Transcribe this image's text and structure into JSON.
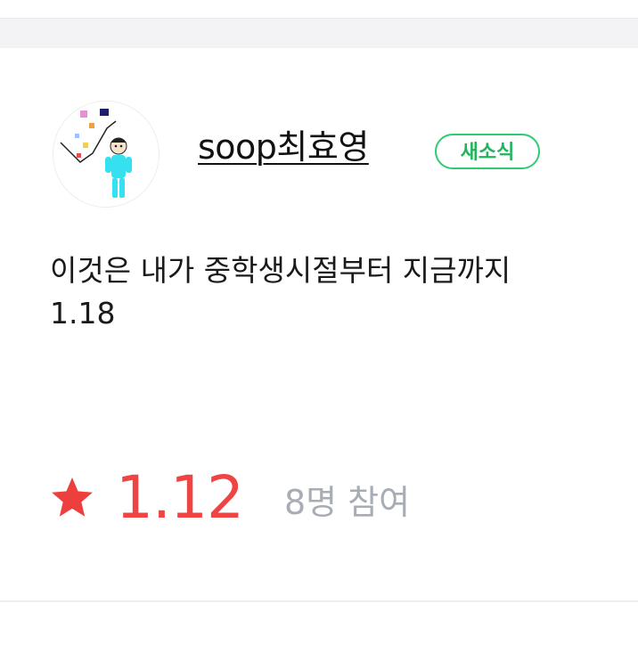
{
  "post": {
    "author": "soop최효영",
    "badge": "새소식",
    "content_lines": [
      "이것은 내가 중학생시절부터 지금까지",
      "1.18"
    ]
  },
  "rating": {
    "score": "1.12",
    "participants": "8명 참여",
    "star_color": "#ee3f3f"
  },
  "colors": {
    "accent_green": "#2ecc71",
    "rating_red": "#ee4444",
    "muted_gray": "#a8adb5"
  },
  "icons": {
    "rating": "star-icon",
    "avatar": "profile-drawing"
  }
}
